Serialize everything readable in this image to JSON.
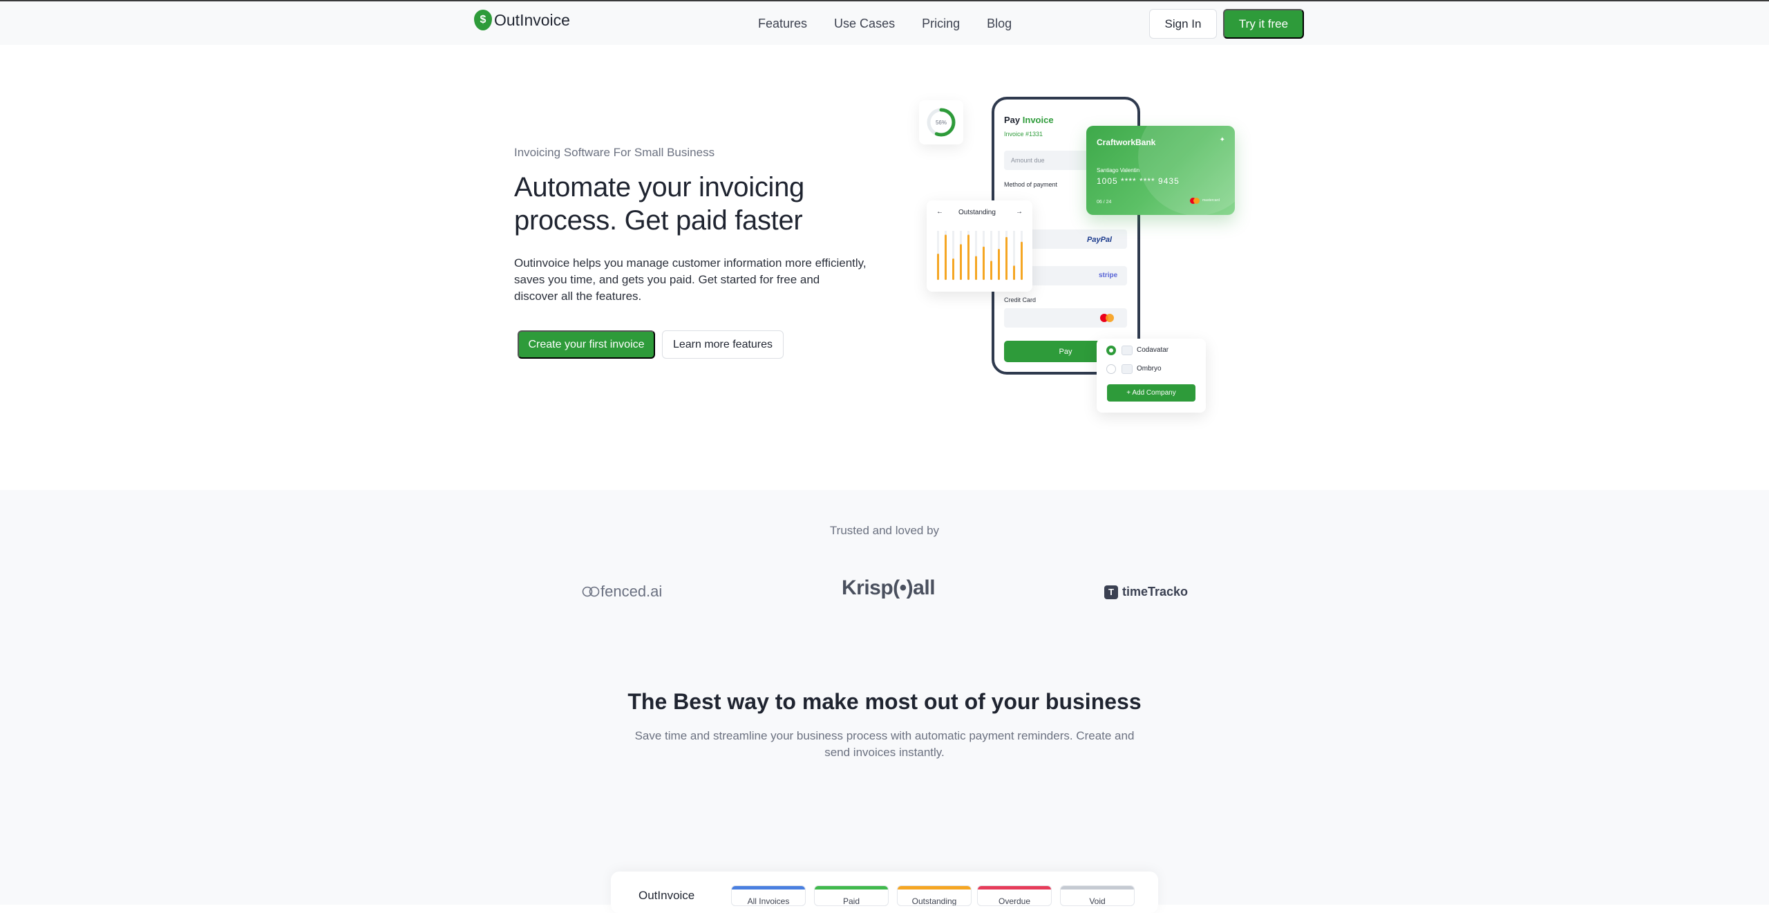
{
  "nav": {
    "logo_text": "OutInvoice",
    "links": [
      "Features",
      "Use Cases",
      "Pricing",
      "Blog"
    ],
    "sign_in": "Sign In",
    "try_free": "Try it free"
  },
  "hero": {
    "eyebrow": "Invoicing Software For Small Business",
    "title": "Automate your invoicing process. Get paid faster",
    "description": "Outinvoice helps you manage customer information more efficiently, saves you time, and gets you paid. Get started for free and discover all the features.",
    "cta_primary": "Create your first invoice",
    "cta_secondary": "Learn more features"
  },
  "illustration": {
    "donut_percent": 56,
    "donut_label": "56%",
    "pay_title_a": "Pay",
    "pay_title_b": "Invoice",
    "invoice_no": "Invoice #1331",
    "amount_due": "Amount due",
    "method_label": "Method of payment",
    "paypal": "PayPal",
    "stripe": "stripe",
    "credit_card": "Credit Card",
    "pay_button": "Pay",
    "bank": {
      "name": "CraftworkBank",
      "holder": "Santiago Valentin",
      "number": "1005  ****  ****  9435",
      "expiry": "06 / 24",
      "brand": "mastercard"
    },
    "outstanding": {
      "title": "Outstanding",
      "prev": "←",
      "next": "→",
      "bars": [
        0.55,
        0.95,
        0.45,
        0.75,
        0.95,
        0.5,
        0.7,
        0.4,
        0.65,
        0.9,
        0.3,
        0.8
      ]
    },
    "companies": [
      {
        "name": "Codavatar",
        "selected": true
      },
      {
        "name": "Ombryo",
        "selected": false
      }
    ],
    "add_company": "+  Add Company"
  },
  "trusted": {
    "label": "Trusted and loved by",
    "logos": [
      "fenced.ai",
      "Krisp(•)all",
      "timeTracko"
    ]
  },
  "section": {
    "title": "The Best way to make most out of your business",
    "description": "Save time and streamline your business process with automatic payment reminders. Create and send invoices instantly."
  },
  "panel": {
    "brand": "OutInvoice",
    "tabs": [
      {
        "label": "All Invoices",
        "color": "#4a7fe0"
      },
      {
        "label": "Paid",
        "color": "#41b94d"
      },
      {
        "label": "Outstanding",
        "color": "#f5a623"
      },
      {
        "label": "Overdue",
        "color": "#e63c5a"
      },
      {
        "label": "Void",
        "color": "#c5cad2"
      }
    ]
  },
  "colors": {
    "brand_green": "#2e9b3a",
    "chart_bar": "#f5a623",
    "text_dark": "#1f2430",
    "text_muted": "#6b7180"
  }
}
